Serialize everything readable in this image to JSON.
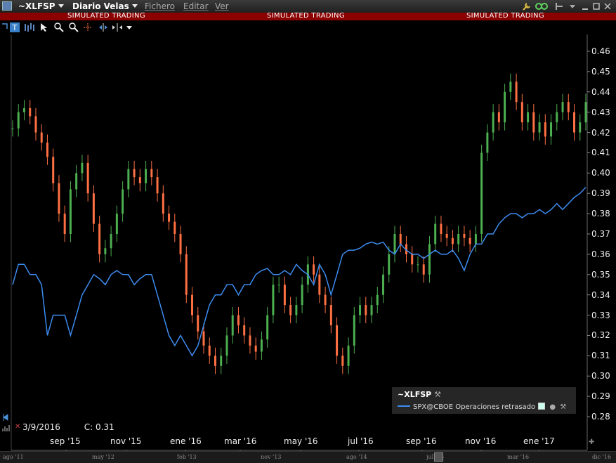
{
  "window": {
    "symbol": "~XLFSP",
    "chart_type": "Diario Velas",
    "menus": [
      "Fichero",
      "Editar",
      "Ver"
    ],
    "banner": "SIMULATED TRADING"
  },
  "toolbar": {
    "icons": [
      "text-tool-icon",
      "bar-style-icon",
      "cursor-icon",
      "zoom-in-icon",
      "zoom-out-icon",
      "crosshair-icon",
      "split-icon",
      "expand-icon",
      "dropdown-icon"
    ]
  },
  "legend": {
    "primary": "~XLFSP",
    "secondary": "SPX@CBOE Operaciones retrasado"
  },
  "status": {
    "date": "3/9/2016",
    "close": "C: 0.31"
  },
  "chart_data": {
    "type": "line",
    "yaxis_ticks": [
      "0.46",
      "0.45",
      "0.44",
      "0.43",
      "0.42",
      "0.41",
      "0.40",
      "0.39",
      "0.38",
      "0.37",
      "0.36",
      "0.35",
      "0.34",
      "0.33",
      "0.32",
      "0.31",
      "0.30",
      "0.29",
      "0.28"
    ],
    "ylim": [
      0.275,
      0.465
    ],
    "x_tick_labels": [
      "sep '15",
      "nov '15",
      "ene '16",
      "mar '16",
      "may '16",
      "jul '16",
      "sep '16",
      "nov '16",
      "ene '17"
    ],
    "overview_labels": [
      "ago '11",
      "may '12",
      "feb '13",
      "nov '13",
      "ago '14",
      "jul '15",
      "mar '16",
      "dic '16"
    ],
    "series": [
      {
        "name": "~XLFSP",
        "style": "candlestick",
        "up_color": "#4caf50",
        "down_color": "#ff7043",
        "values": [
          0.422,
          0.43,
          0.432,
          0.428,
          0.42,
          0.415,
          0.408,
          0.395,
          0.38,
          0.37,
          0.392,
          0.4,
          0.405,
          0.39,
          0.375,
          0.36,
          0.363,
          0.37,
          0.38,
          0.392,
          0.402,
          0.398,
          0.395,
          0.402,
          0.398,
          0.39,
          0.38,
          0.376,
          0.37,
          0.36,
          0.34,
          0.33,
          0.322,
          0.315,
          0.31,
          0.305,
          0.31,
          0.32,
          0.33,
          0.325,
          0.32,
          0.315,
          0.312,
          0.318,
          0.33,
          0.345,
          0.345,
          0.335,
          0.33,
          0.335,
          0.345,
          0.355,
          0.35,
          0.34,
          0.335,
          0.325,
          0.31,
          0.305,
          0.315,
          0.33,
          0.335,
          0.33,
          0.335,
          0.34,
          0.35,
          0.36,
          0.37,
          0.365,
          0.36,
          0.355,
          0.355,
          0.35,
          0.365,
          0.375,
          0.37,
          0.368,
          0.365,
          0.37,
          0.368,
          0.365,
          0.37,
          0.41,
          0.42,
          0.43,
          0.425,
          0.44,
          0.445,
          0.435,
          0.425,
          0.43,
          0.42,
          0.425,
          0.418,
          0.425,
          0.43,
          0.435,
          0.43,
          0.42,
          0.425,
          0.435
        ]
      },
      {
        "name": "SPX@CBOE Operaciones retrasado",
        "style": "line",
        "color": "#3c8cf0",
        "values": [
          0.345,
          0.355,
          0.355,
          0.35,
          0.35,
          0.345,
          0.32,
          0.33,
          0.33,
          0.33,
          0.32,
          0.33,
          0.34,
          0.345,
          0.35,
          0.348,
          0.345,
          0.35,
          0.352,
          0.35,
          0.35,
          0.345,
          0.348,
          0.35,
          0.35,
          0.34,
          0.33,
          0.32,
          0.315,
          0.32,
          0.315,
          0.31,
          0.315,
          0.325,
          0.335,
          0.34,
          0.34,
          0.345,
          0.345,
          0.34,
          0.345,
          0.345,
          0.35,
          0.352,
          0.353,
          0.35,
          0.35,
          0.352,
          0.35,
          0.355,
          0.352,
          0.35,
          0.345,
          0.355,
          0.35,
          0.34,
          0.35,
          0.36,
          0.362,
          0.362,
          0.363,
          0.365,
          0.366,
          0.365,
          0.366,
          0.362,
          0.36,
          0.365,
          0.362,
          0.36,
          0.36,
          0.358,
          0.36,
          0.362,
          0.36,
          0.36,
          0.362,
          0.358,
          0.352,
          0.36,
          0.365,
          0.365,
          0.37,
          0.37,
          0.375,
          0.378,
          0.38,
          0.38,
          0.378,
          0.38,
          0.38,
          0.382,
          0.38,
          0.382,
          0.385,
          0.382,
          0.385,
          0.388,
          0.39,
          0.393
        ]
      }
    ]
  },
  "colors": {
    "banner": "#8b0000",
    "background": "#000000",
    "grid": "none"
  }
}
